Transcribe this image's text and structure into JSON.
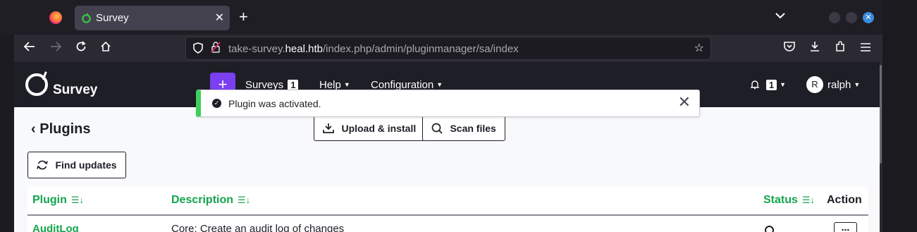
{
  "browser": {
    "tab_title": "Survey",
    "tab_close": "✕",
    "new_tab": "+",
    "url_protocol_host_prefix": "take-survey.",
    "url_host": "heal.htb",
    "url_path": "/index.php/admin/pluginmanager/sa/index"
  },
  "topnav": {
    "brand": "Survey",
    "plus": "+",
    "surveys_label": "Surveys",
    "surveys_count": "1",
    "help_label": "Help",
    "configuration_label": "Configuration",
    "notifications_count": "1",
    "avatar_initial": "R",
    "user_name": "ralph"
  },
  "alert": {
    "message": "Plugin was activated.",
    "close": "✕"
  },
  "page": {
    "title": "Plugins",
    "upload_label": "Upload & install",
    "scan_label": "Scan files",
    "find_updates_label": "Find updates"
  },
  "table": {
    "columns": [
      "Plugin",
      "Description",
      "Status",
      "Action"
    ],
    "rows": [
      {
        "plugin": "AuditLog",
        "description": "Core: Create an audit log of changes",
        "action": "..."
      }
    ]
  },
  "colors": {
    "accent_green": "#14a44d",
    "alert_green": "#3ecf5a",
    "plus_purple": "#7b3ff2",
    "navbar_dark": "#1e1e27"
  }
}
